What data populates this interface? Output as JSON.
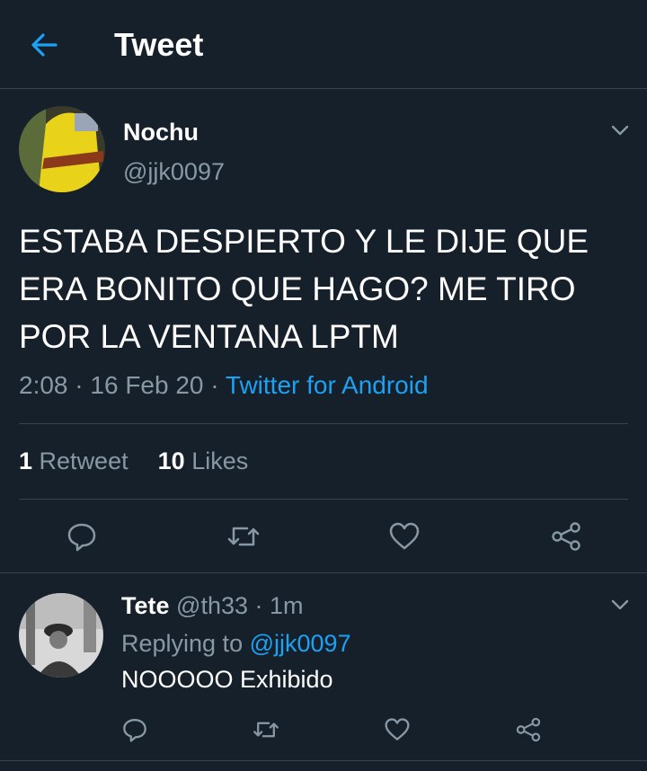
{
  "header": {
    "title": "Tweet",
    "icon": "back-arrow-icon"
  },
  "tweet": {
    "name": "Nochu",
    "handle": "@jjk0097",
    "text": "ESTABA DESPIERTO Y LE DIJE QUE ERA BONITO QUE HAGO? ME TIRO POR LA VENTANA LPTM",
    "time": "2:08",
    "date": "16 Feb 20",
    "source": "Twitter for Android",
    "retweets_count": "1",
    "retweets_label": "Retweet",
    "likes_count": "10",
    "likes_label": "Likes"
  },
  "reply": {
    "name": "Tete",
    "handle": "@th33",
    "age": "1m",
    "replying_prefix": "Replying to",
    "replying_to": "@jjk0097",
    "text": "NOOOOO Exhibido"
  },
  "colors": {
    "background": "#15202b",
    "accent": "#1da1f2",
    "secondary": "#8899a6",
    "divider": "#38444d"
  },
  "icons": [
    "back-arrow-icon",
    "chevron-down-icon",
    "reply-icon",
    "retweet-icon",
    "like-icon",
    "share-icon"
  ]
}
